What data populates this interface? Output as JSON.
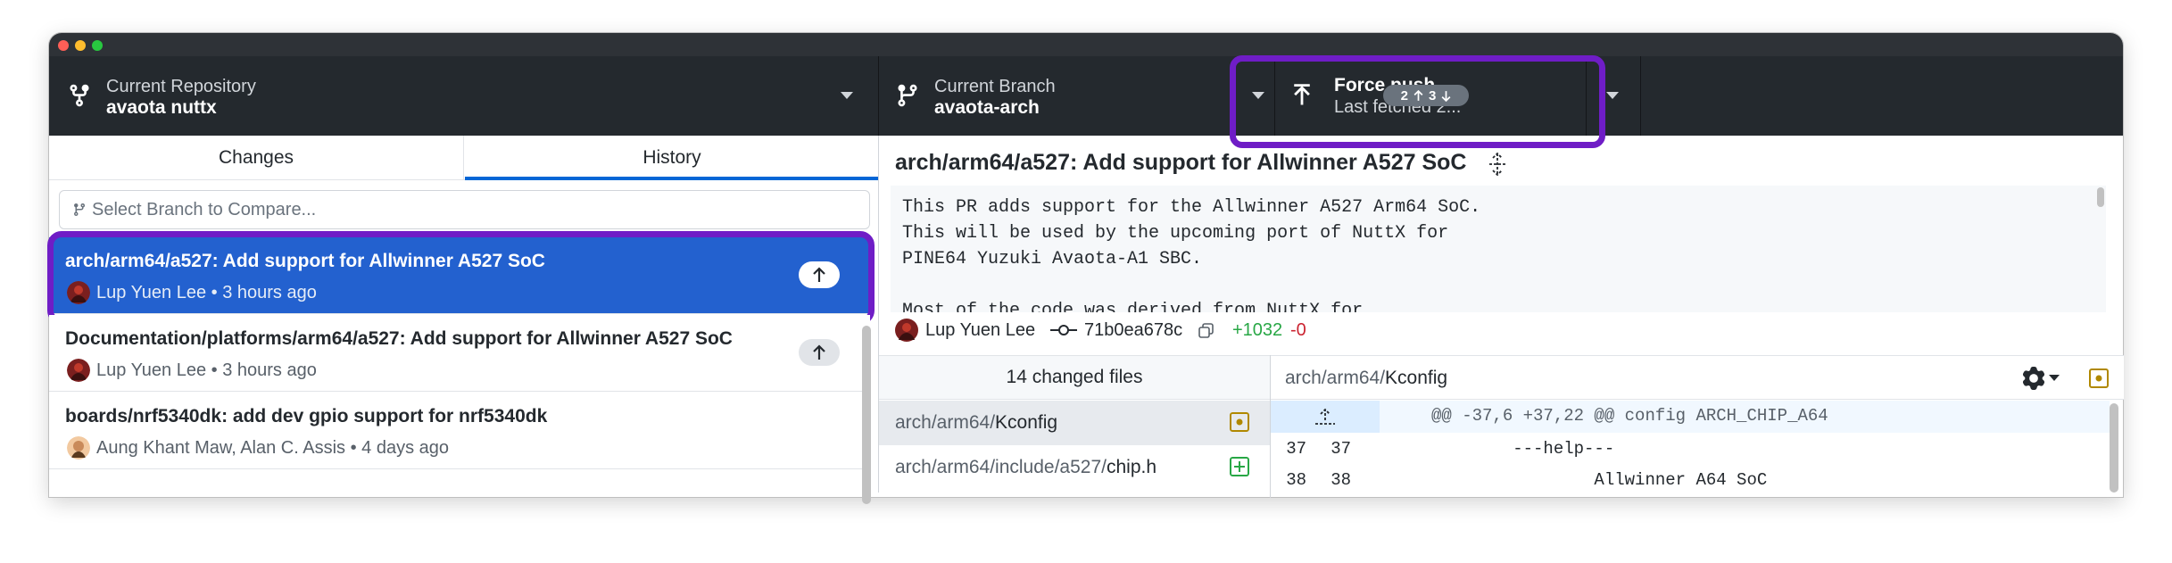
{
  "window": {
    "traffic_lights": [
      "#ff5f57",
      "#febc2e",
      "#28c840"
    ]
  },
  "toolbar": {
    "repository": {
      "label": "Current Repository",
      "value": "avaota nuttx"
    },
    "branch": {
      "label": "Current Branch",
      "value": "avaota-arch"
    },
    "push": {
      "label": "Force push ...",
      "status": "Last fetched 2...",
      "ahead": "2",
      "behind": "3"
    }
  },
  "tabs": {
    "changes": "Changes",
    "history": "History",
    "selected": "History"
  },
  "compare": {
    "placeholder": "Select Branch to Compare..."
  },
  "commits": [
    {
      "message": "arch/arm64/a527: Add support for Allwinner A527 SoC",
      "author_time": "Lup Yuen Lee • 3 hours ago",
      "unpushed": true,
      "selected": true
    },
    {
      "message": "Documentation/platforms/arm64/a527: Add support for Allwinner A527 SoC",
      "author_time": "Lup Yuen Lee • 3 hours ago",
      "unpushed": true,
      "selected": false
    },
    {
      "message": "boards/nrf5340dk: add dev gpio support for nrf5340dk",
      "author_time": "Aung Khant Maw, Alan C. Assis • 4 days ago",
      "unpushed": false,
      "selected": false
    }
  ],
  "detail": {
    "title": "arch/arm64/a527: Add support for Allwinner A527 SoC",
    "description": "This PR adds support for the Allwinner A527 Arm64 SoC.\nThis will be used by the upcoming port of NuttX for\nPINE64 Yuzuki Avaota-A1 SBC.\n\nMost of the code was derived from NuttX for",
    "author": "Lup Yuen Lee",
    "sha": "71b0ea678c",
    "additions": "+1032",
    "deletions": "-0"
  },
  "files": {
    "header": "14 changed files",
    "items": [
      {
        "dir": "arch/arm64/",
        "name": "Kconfig",
        "status": "modified"
      },
      {
        "dir": "arch/arm64/include/a527/",
        "name": "chip.h",
        "status": "added"
      }
    ]
  },
  "diff": {
    "path_dir": "arch/arm64/",
    "path_name": "Kconfig",
    "hunk": "@@ -37,6 +37,22 @@ config ARCH_CHIP_A64",
    "lines": [
      {
        "old": "37",
        "new": "37",
        "code": "        ---help---"
      },
      {
        "old": "38",
        "new": "38",
        "code": "                Allwinner A64 SoC"
      }
    ]
  },
  "colors": {
    "accent": "#0366d6",
    "selection": "#2361cf",
    "highlight": "#6f1dc6",
    "added": "#28a745",
    "removed": "#cb2431",
    "modified": "#b08800"
  },
  "icons": [
    "repo-fork-icon",
    "branch-icon",
    "arrow-up-icon",
    "chevron-down-icon",
    "git-commit-icon",
    "copy-icon",
    "gear-icon",
    "expand-icon",
    "file-modified-icon",
    "file-added-icon"
  ]
}
